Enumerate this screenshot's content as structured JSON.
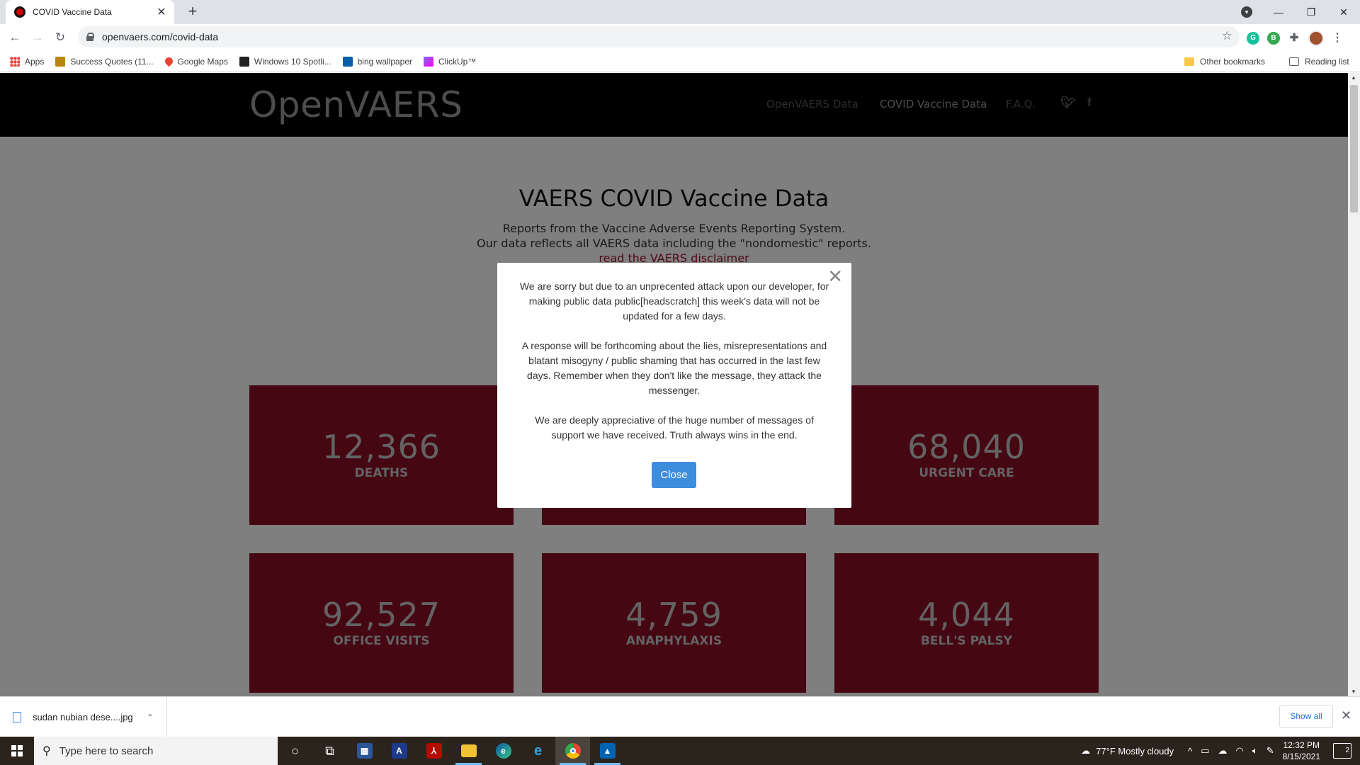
{
  "browser": {
    "tab_title": "COVID Vaccine Data",
    "new_tab_symbol": "+",
    "url": "openvaers.com/covid-data",
    "bookmarks": [
      {
        "label": "Apps"
      },
      {
        "label": "Success Quotes (11..."
      },
      {
        "label": "Google Maps"
      },
      {
        "label": "Windows 10 Spotli..."
      },
      {
        "label": "bing wallpaper"
      },
      {
        "label": "ClickUp™"
      }
    ],
    "other_bookmarks": "Other bookmarks",
    "reading_list": "Reading list"
  },
  "site": {
    "logo": "OpenVAERS",
    "nav": [
      {
        "label": "OpenVAERS Data"
      },
      {
        "label": "COVID Vaccine Data"
      },
      {
        "label": "F.A.Q."
      }
    ],
    "hero_title": "VAERS COVID Vaccine Data",
    "hero_line1": "Reports from the Vaccine Adverse Events Reporting System.",
    "hero_line2": "Our data reflects all VAERS data including the \"nondomestic\" reports.",
    "hero_link": "read the VAERS disclaimer",
    "cards": [
      {
        "value": "12,366",
        "label": "DEATHS"
      },
      {
        "value": "",
        "label": ""
      },
      {
        "value": "68,040",
        "label": "URGENT CARE"
      },
      {
        "value": "92,527",
        "label": "OFFICE VISITS"
      },
      {
        "value": "4,759",
        "label": "ANAPHYLAXIS"
      },
      {
        "value": "4,044",
        "label": "BELL'S PALSY"
      }
    ]
  },
  "modal": {
    "paragraph1": "We are sorry but due to an unprecented attack upon our developer, for making public data public[headscratch] this week's data will not be updated for a few days.",
    "paragraph2": "A response will be forthcoming about the lies, misrepresentations and blatant misogyny / public shaming that has occurred in the last few days. Remember when they don't like the message, they attack the messenger.",
    "paragraph3": "We are deeply appreciative of the huge number of messages of support we have received. Truth always wins in the end.",
    "close_button": "Close"
  },
  "downloads": {
    "file_name": "sudan nubian dese....jpg",
    "show_all": "Show all"
  },
  "taskbar": {
    "search_placeholder": "Type here to search",
    "weather": "77°F  Mostly cloudy",
    "time": "12:32 PM",
    "date": "8/15/2021",
    "notifications": "2"
  },
  "colors": {
    "card_red": "#8b0f25",
    "modal_button": "#3c8dde",
    "nav_bg": "#000000"
  }
}
